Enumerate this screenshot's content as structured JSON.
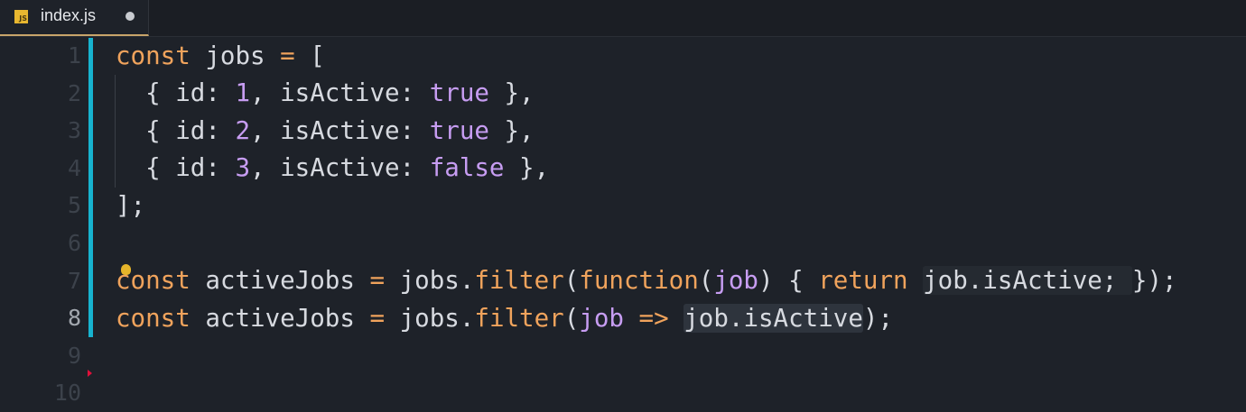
{
  "tab": {
    "filename": "index.js",
    "icon": "js-file-icon",
    "modified": true,
    "icon_label": "JS"
  },
  "line_numbers": [
    "1",
    "2",
    "3",
    "4",
    "5",
    "6",
    "7",
    "8",
    "9",
    "10"
  ],
  "current_line": 8,
  "colors": {
    "background": "#1e2229",
    "keyword": "#f0a35c",
    "number": "#c79df2",
    "text": "#d7dae0",
    "modified_bar": "#17b3cf"
  },
  "code": [
    [
      [
        "const",
        "k"
      ],
      [
        " jobs ",
        ""
      ],
      [
        "=",
        "o"
      ],
      [
        " [",
        ""
      ]
    ],
    [
      [
        "  { id: ",
        ""
      ],
      [
        "1",
        "n"
      ],
      [
        ", isActive: ",
        ""
      ],
      [
        "true",
        "b"
      ],
      [
        " },",
        ""
      ]
    ],
    [
      [
        "  { id: ",
        ""
      ],
      [
        "2",
        "n"
      ],
      [
        ", isActive: ",
        ""
      ],
      [
        "true",
        "b"
      ],
      [
        " },",
        ""
      ]
    ],
    [
      [
        "  { id: ",
        ""
      ],
      [
        "3",
        "n"
      ],
      [
        ", isActive: ",
        ""
      ],
      [
        "false",
        "b"
      ],
      [
        " },",
        ""
      ]
    ],
    [
      [
        "];",
        ""
      ]
    ],
    [],
    [
      [
        "const",
        "k"
      ],
      [
        " activeJobs ",
        ""
      ],
      [
        "=",
        "o"
      ],
      [
        " jobs.",
        ""
      ],
      [
        "filter",
        "f"
      ],
      [
        "(",
        ""
      ],
      [
        "function",
        "k"
      ],
      [
        "(",
        ""
      ],
      [
        "job",
        "p"
      ],
      [
        ") { ",
        ""
      ],
      [
        "return",
        "k"
      ],
      [
        " ",
        ""
      ],
      [
        "job.isActive; ",
        "hl1"
      ],
      [
        "});",
        ""
      ]
    ],
    [
      [
        "const",
        "k"
      ],
      [
        " activeJobs ",
        ""
      ],
      [
        "=",
        "o"
      ],
      [
        " jobs.",
        ""
      ],
      [
        "filter",
        "f"
      ],
      [
        "(",
        ""
      ],
      [
        "job",
        "p"
      ],
      [
        " ",
        ""
      ],
      [
        "=>",
        "o"
      ],
      [
        " ",
        ""
      ],
      [
        "job.isActive",
        "hl2"
      ],
      [
        ");",
        ""
      ]
    ],
    []
  ]
}
